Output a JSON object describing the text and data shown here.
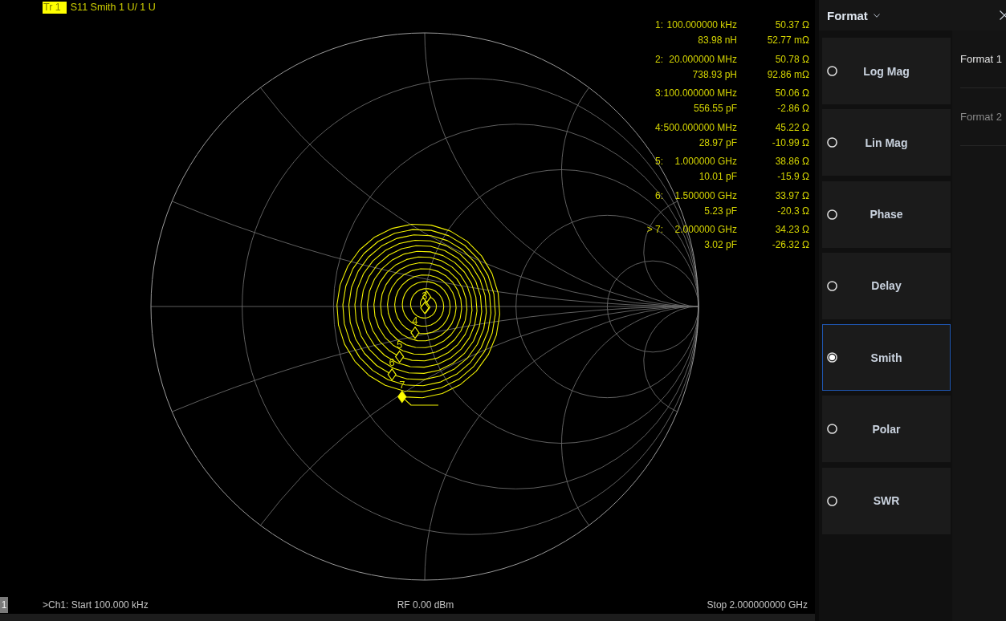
{
  "trace": {
    "label": "Tr 1",
    "selected": true,
    "description": "S11 Smith 1 U/ 1 U"
  },
  "marker_table": [
    {
      "id": "1:",
      "stimulus": "100.000000 kHz",
      "equivalent": "83.98 nH",
      "resistance": "50.37 Ω",
      "reactance": "52.77 mΩ"
    },
    {
      "id": "2:",
      "stimulus": "20.000000 MHz",
      "equivalent": "738.93 pH",
      "resistance": "50.78 Ω",
      "reactance": "92.86 mΩ"
    },
    {
      "id": "3:",
      "stimulus": "100.000000 MHz",
      "equivalent": "556.55 pF",
      "resistance": "50.06 Ω",
      "reactance": "-2.86 Ω"
    },
    {
      "id": "4:",
      "stimulus": "500.000000 MHz",
      "equivalent": "28.97 pF",
      "resistance": "45.22 Ω",
      "reactance": "-10.99 Ω"
    },
    {
      "id": "5:",
      "stimulus": "1.000000 GHz",
      "equivalent": "10.01 pF",
      "resistance": "38.86 Ω",
      "reactance": "-15.9 Ω"
    },
    {
      "id": "6:",
      "stimulus": "1.500000 GHz",
      "equivalent": "5.23 pF",
      "resistance": "33.97 Ω",
      "reactance": "-20.3 Ω"
    },
    {
      "id": "> 7:",
      "stimulus": "2.000000 GHz",
      "equivalent": "3.02 pF",
      "resistance": "34.23 Ω",
      "reactance": "-26.32 Ω"
    }
  ],
  "chart": {
    "markers": [
      {
        "active": false
      },
      {
        "active": false
      },
      {
        "label": "3",
        "active": false
      },
      {
        "label": "4",
        "active": false
      },
      {
        "label": "5",
        "active": false
      },
      {
        "label": "6",
        "active": false
      },
      {
        "label": "7",
        "active": true
      }
    ]
  },
  "status_bar": {
    "channel_badge": "1",
    "start": ">Ch1: Start 100.000 kHz",
    "power": "RF 0.00 dBm",
    "stop": "Stop 2.000000000 GHz"
  },
  "panel": {
    "title": "Format",
    "options": [
      {
        "label": "Log Mag",
        "selected": false
      },
      {
        "label": "Lin Mag",
        "selected": false
      },
      {
        "label": "Phase",
        "selected": false
      },
      {
        "label": "Delay",
        "selected": false
      },
      {
        "label": "Smith",
        "selected": true
      },
      {
        "label": "Polar",
        "selected": false
      },
      {
        "label": "SWR",
        "selected": false
      }
    ],
    "tabs": [
      {
        "label": "Format 1",
        "selected": true
      },
      {
        "label": "Format 2",
        "selected": false
      }
    ]
  }
}
